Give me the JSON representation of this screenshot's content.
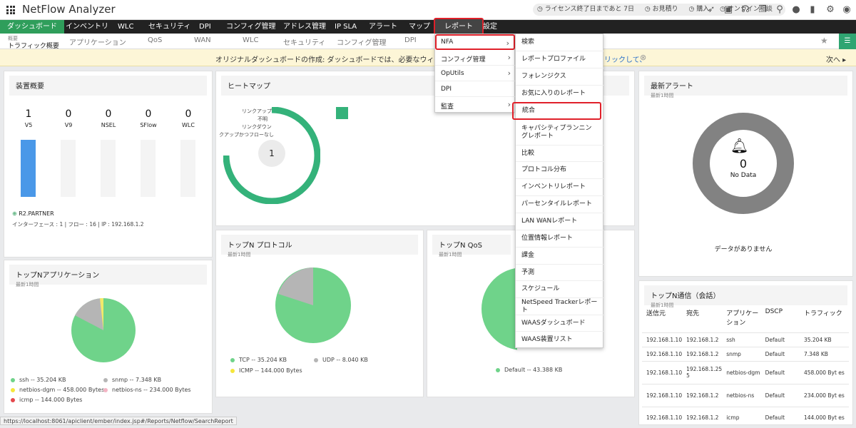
{
  "app": {
    "title": "NetFlow Analyzer"
  },
  "topbar": {
    "license_text": "ライセンス終了日まであと 7日",
    "quote": "お見積り",
    "buy": "購入",
    "consult": "オンライン相談"
  },
  "nav": {
    "items": [
      "ダッシュボード",
      "インベントリ",
      "WLC",
      "セキュリティ",
      "DPI",
      "コンフィグ管理",
      "アドレス管理",
      "IP SLA",
      "アラート",
      "マップ",
      "レポート",
      "設定"
    ]
  },
  "subnav": {
    "active_small": "概要",
    "active_label": "トラフィック概要",
    "items": [
      "アプリケーション",
      "QoS",
      "WAN",
      "WLC",
      "セキュリティ",
      "コンフィグ管理",
      "DPI"
    ]
  },
  "banner": {
    "text": "オリジナルダッシュボードの作成: ダッシュボードでは、必要なウィジェットを追加し",
    "link_fragment": "リックして、",
    "next": "次へ"
  },
  "device_summary": {
    "title": "装置概要",
    "counts": [
      {
        "label": "V5",
        "value": "1"
      },
      {
        "label": "V9",
        "value": "0"
      },
      {
        "label": "NSEL",
        "value": "0"
      },
      {
        "label": "SFlow",
        "value": "0"
      },
      {
        "label": "WLC",
        "value": "0"
      }
    ],
    "device_name": "R2.PARTNER",
    "device_info": "インターフェース : 1 | フロー : 16 | IP : 192.168.1.2"
  },
  "heatmap": {
    "title": "ヒートマップ",
    "legend": [
      "リンクアップ",
      "不明",
      "リンクダウン",
      "クアップかつフローなし"
    ],
    "center_value": "1"
  },
  "alerts": {
    "title": "最新アラート",
    "subtitle": "最新1時間",
    "center_value": "0",
    "center_label": "No Data",
    "empty_text": "データがありません"
  },
  "top_apps": {
    "title": "トップNアプリケーション",
    "subtitle": "最新1時間",
    "legend": [
      "ssh -- 35.204 KB",
      "snmp -- 7.348 KB",
      "netbios-dgm -- 458.000 Bytes",
      "netbios-ns -- 234.000 Bytes",
      "icmp -- 144.000 Bytes"
    ]
  },
  "top_protocols": {
    "title": "トップN プロトコル",
    "subtitle": "最新1時間",
    "legend": [
      "TCP -- 35.204 KB",
      "UDP -- 8.040 KB",
      "ICMP -- 144.000 Bytes"
    ]
  },
  "top_qos": {
    "title": "トップN QoS",
    "subtitle": "最新1時間",
    "legend": [
      "Default -- 43.388 KB"
    ]
  },
  "top_talk": {
    "title": "トップN通信（会話）",
    "subtitle": "最新1時間",
    "headers": [
      "送信元",
      "宛先",
      "アプリケーション",
      "DSCP",
      "トラフィック"
    ],
    "rows": [
      [
        "192.168.1.10",
        "192.168.1.2",
        "ssh",
        "Default",
        "35.204 KB"
      ],
      [
        "192.168.1.10",
        "192.168.1.2",
        "snmp",
        "Default",
        "7.348 KB"
      ],
      [
        "192.168.1.10",
        "192.168.1.25 5",
        "netbios-dgm",
        "Default",
        "458.000 Byt es"
      ],
      [
        "192.168.1.10",
        "192.168.1.2",
        "netbios-ns",
        "Default",
        "234.000 Byt es"
      ],
      [
        "192.168.1.10",
        "192.168.1.2",
        "icmp",
        "Default",
        "144.000 Byt es"
      ]
    ]
  },
  "menu_nfa": {
    "items": [
      "NFA",
      "コンフィグ管理",
      "OpUtils",
      "DPI",
      "監査"
    ]
  },
  "menu_report": {
    "items": [
      "検索",
      "レポートプロファイル",
      "フォレンジクス",
      "お気に入りのレポート",
      "統合",
      "キャパシティプランニングレポート",
      "比較",
      "プロトコル分布",
      "インベントリレポート",
      "パーセンタイルレポート",
      "LAN WANレポート",
      "位置情報レポート",
      "課金",
      "予測",
      "スケジュール",
      "NetSpeed Trackerレポート",
      "WAASダッシュボード",
      "WAAS装置リスト"
    ]
  },
  "statusbar": {
    "url": "https://localhost:8061/apiclient/ember/index.jsp#/Reports/Netflow/SearchReport"
  },
  "colors": {
    "green": "#2f9e5b",
    "pie_green": "#6fd38a",
    "pie_gray": "#b5b5b5",
    "selection_red": "#e0202a"
  }
}
